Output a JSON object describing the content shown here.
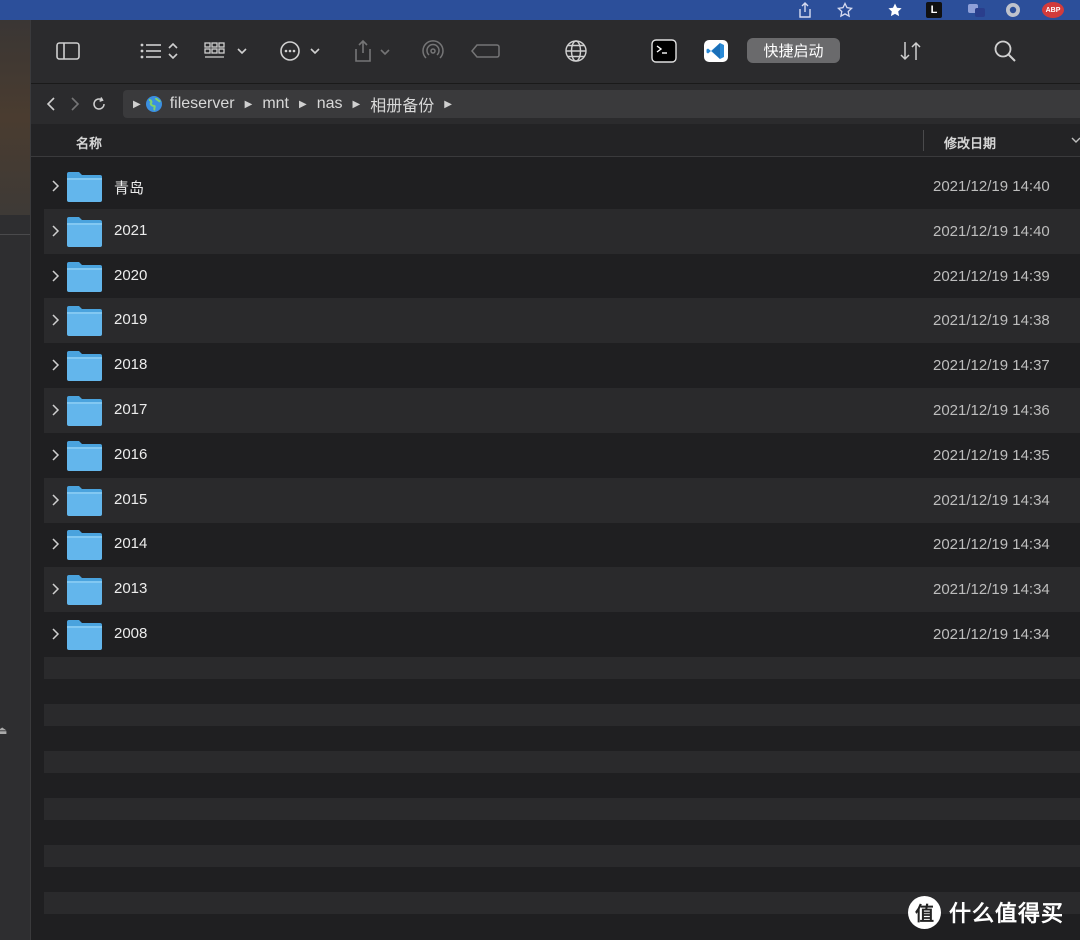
{
  "browser": {
    "ext_l_label": "L",
    "ext_abp_label": "ABP"
  },
  "toolbar": {
    "quick_launch_label": "快捷启动"
  },
  "pathbar": {
    "crumbs": [
      "fileserver",
      "mnt",
      "nas",
      "相册备份"
    ]
  },
  "columns": {
    "name": "名称",
    "date_modified": "修改日期"
  },
  "files": [
    {
      "name": "青岛",
      "date": "2021/12/19 14:40"
    },
    {
      "name": "2021",
      "date": "2021/12/19 14:40"
    },
    {
      "name": "2020",
      "date": "2021/12/19 14:39"
    },
    {
      "name": "2019",
      "date": "2021/12/19 14:38"
    },
    {
      "name": "2018",
      "date": "2021/12/19 14:37"
    },
    {
      "name": "2017",
      "date": "2021/12/19 14:36"
    },
    {
      "name": "2016",
      "date": "2021/12/19 14:35"
    },
    {
      "name": "2015",
      "date": "2021/12/19 14:34"
    },
    {
      "name": "2014",
      "date": "2021/12/19 14:34"
    },
    {
      "name": "2013",
      "date": "2021/12/19 14:34"
    },
    {
      "name": "2008",
      "date": "2021/12/19 14:34"
    }
  ],
  "watermark": {
    "logo": "值",
    "text": "什么值得买"
  },
  "colors": {
    "folder_blue": "#5fb4ea",
    "browser_bar": "#2c4f9a",
    "window_bg": "#1f1f21",
    "row_stripe": "#2a2a2c"
  }
}
